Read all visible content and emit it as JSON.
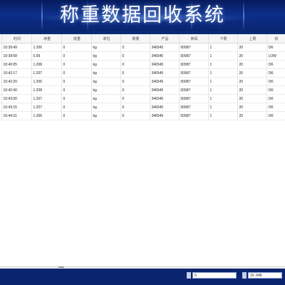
{
  "app": {
    "title": "称重数据回收系统"
  },
  "colors": {
    "header_bg": "#0c2e8a",
    "status_bg": "#0a2470",
    "grid_bg": "#ffffff"
  },
  "grid": {
    "columns": [
      "",
      "时间",
      "净重",
      "皮重",
      "单位",
      "数量",
      "产品",
      "条码",
      "下限",
      "上限",
      "状"
    ],
    "rows": [
      [
        "",
        "10:39:49",
        "1.206",
        "0",
        "kg",
        "0",
        "346545",
        "00987",
        "1",
        "20",
        "OK"
      ],
      [
        "",
        "10:39:58",
        "0.99",
        "0",
        "kg",
        "0",
        "346545",
        "00987",
        "1",
        "20",
        "LOW"
      ],
      [
        "",
        "10:40:05",
        "1.208",
        "0",
        "kg",
        "0",
        "346545",
        "00987",
        "1",
        "20",
        "OK"
      ],
      [
        "",
        "10:42:17",
        "1.207",
        "0",
        "kg",
        "0",
        "346545",
        "00987",
        "1",
        "20",
        "OK"
      ],
      [
        "",
        "10:42:20",
        "1.206",
        "0",
        "kg",
        "0",
        "346545",
        "00987",
        "1",
        "20",
        "OK"
      ],
      [
        "",
        "10:42:40",
        "1.208",
        "0",
        "kg",
        "0",
        "346545",
        "00987",
        "1",
        "20",
        "OK"
      ],
      [
        "",
        "10:43:00",
        "1.207",
        "0",
        "kg",
        "0",
        "346545",
        "00987",
        "1",
        "20",
        "OK"
      ],
      [
        "",
        "10:43:15",
        "1.207",
        "0",
        "kg",
        "0",
        "346545",
        "00987",
        "1",
        "20",
        "OK"
      ],
      [
        "",
        "10:44:31",
        "1.206",
        "0",
        "kg",
        "0",
        "346545",
        "00987",
        "1",
        "20",
        "OK"
      ]
    ]
  },
  "status": {
    "field1_value": "0",
    "field2_value": "10 .645"
  }
}
